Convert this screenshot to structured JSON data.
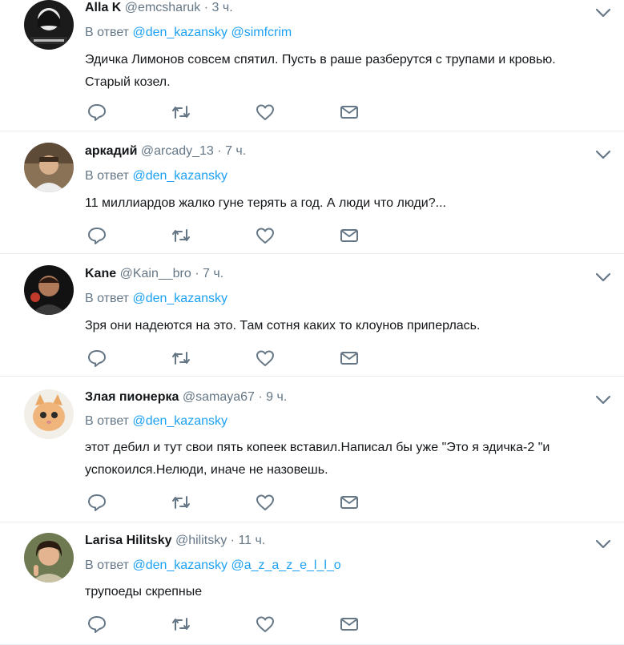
{
  "labels": {
    "reply_prefix": "В ответ"
  },
  "tweets": [
    {
      "name": "Alla K",
      "handle": "@emcsharuk",
      "dot": "·",
      "time": "3 ч.",
      "mentions": [
        "@den_kazansky",
        "@simfcrim"
      ],
      "text": "Эдичка Лимонов совсем спятил. Пусть в раше разберутся с трупами и кровью. Старый козел.",
      "avatar_logo_text": "НАША ЖЕНЩИНА"
    },
    {
      "name": "аркадий",
      "handle": "@arcady_13",
      "dot": "·",
      "time": "7 ч.",
      "mentions": [
        "@den_kazansky"
      ],
      "text": "11 миллиардов жалко гуне терять а год. А люди что люди?..."
    },
    {
      "name": "Kane",
      "handle": "@Kain__bro",
      "dot": "·",
      "time": "7 ч.",
      "mentions": [
        "@den_kazansky"
      ],
      "text": "Зря они надеются на это. Там сотня  каких то клоунов приперлась."
    },
    {
      "name": "Злая пионерка",
      "handle": "@samaya67",
      "dot": "·",
      "time": "9 ч.",
      "mentions": [
        "@den_kazansky"
      ],
      "text": "этот дебил и тут свои пять копеек вставил.Написал бы уже \"Это я эдичка-2 \"и успокоился.Нелюди, иначе не назовешь."
    },
    {
      "name": "Larisa Hilitsky",
      "handle": "@hilitsky",
      "dot": "·",
      "time": "11 ч.",
      "mentions": [
        "@den_kazansky",
        "@a_z_a_z_e_l_l_o"
      ],
      "text": "трупоеды скрепные"
    }
  ],
  "colors": {
    "accent": "#1da1f2",
    "secondary_text": "#657786",
    "primary_text": "#14171a",
    "divider": "#e6ecf0"
  },
  "icons": [
    "reply-icon",
    "retweet-icon",
    "like-icon",
    "direct-message-icon",
    "chevron-down-icon"
  ]
}
